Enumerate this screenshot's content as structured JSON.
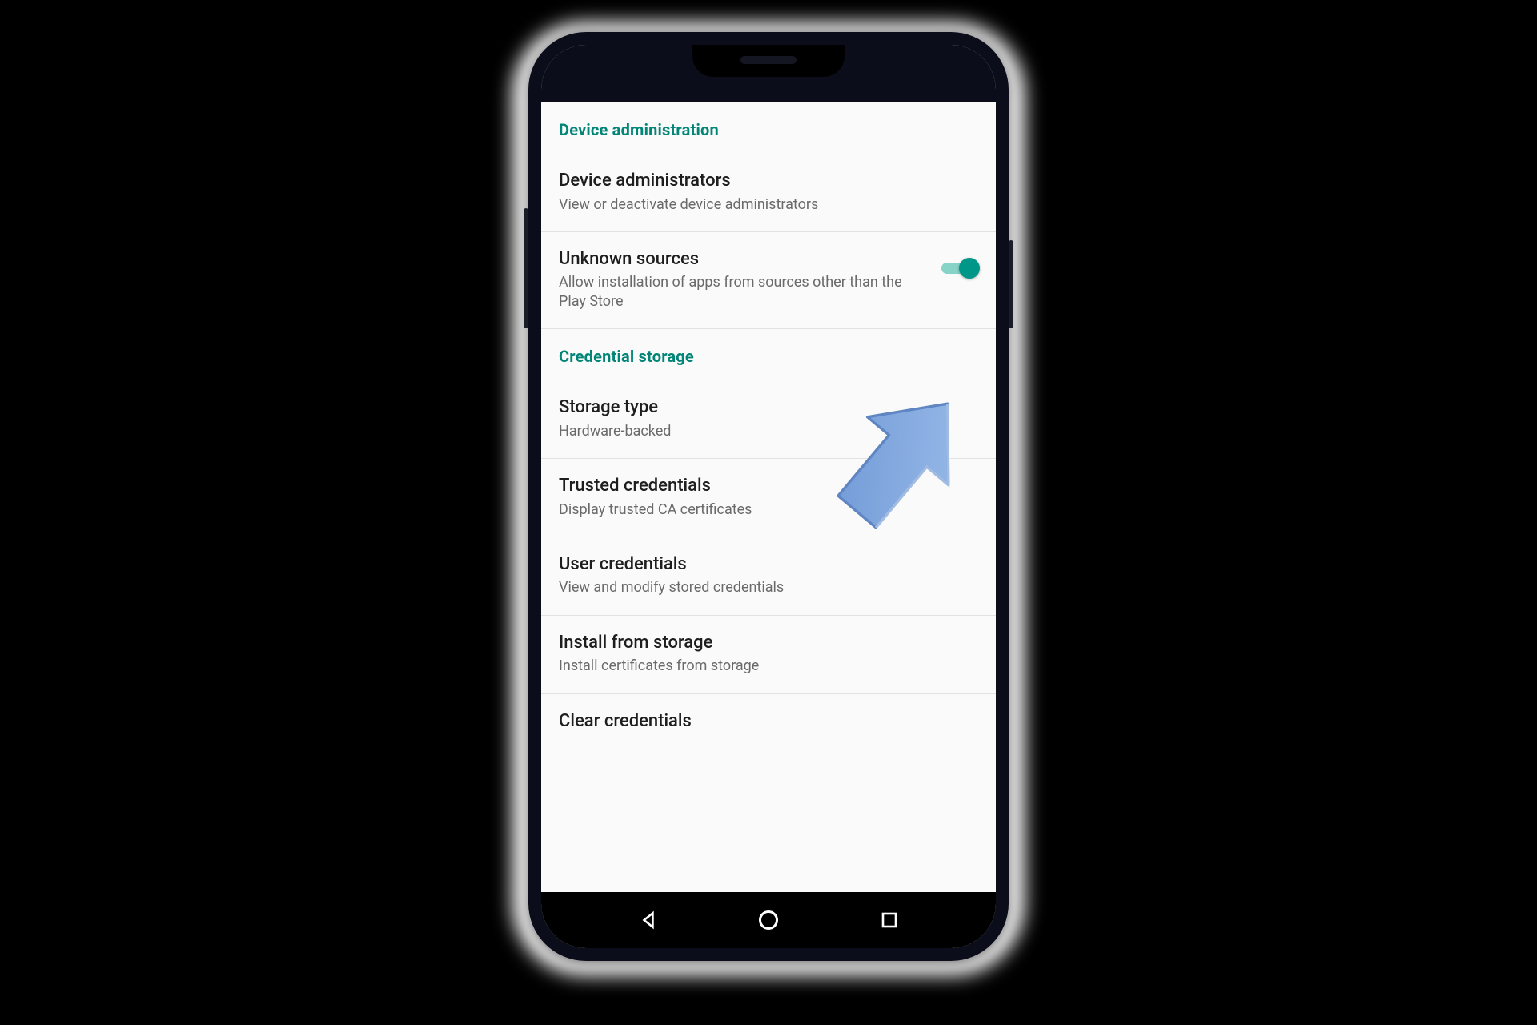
{
  "colors": {
    "accent": "#008577",
    "toggleThumb": "#009688",
    "toggleTrack": "#87d3c7"
  },
  "sections": {
    "deviceAdmin": {
      "header": "Device administration",
      "rows": {
        "admins": {
          "title": "Device administrators",
          "sub": "View or deactivate device administrators"
        },
        "unknown": {
          "title": "Unknown sources",
          "sub": "Allow installation of apps from sources other than the Play Store",
          "toggleOn": true
        }
      }
    },
    "credStorage": {
      "header": "Credential storage",
      "rows": {
        "storageType": {
          "title": "Storage type",
          "sub": "Hardware-backed"
        },
        "trusted": {
          "title": "Trusted credentials",
          "sub": "Display trusted CA certificates"
        },
        "user": {
          "title": "User credentials",
          "sub": "View and modify stored credentials"
        },
        "install": {
          "title": "Install from storage",
          "sub": "Install certificates from storage"
        },
        "clear": {
          "title": "Clear credentials"
        }
      }
    }
  },
  "navbar": {
    "back": "back-icon",
    "home": "home-icon",
    "recent": "recent-icon"
  }
}
